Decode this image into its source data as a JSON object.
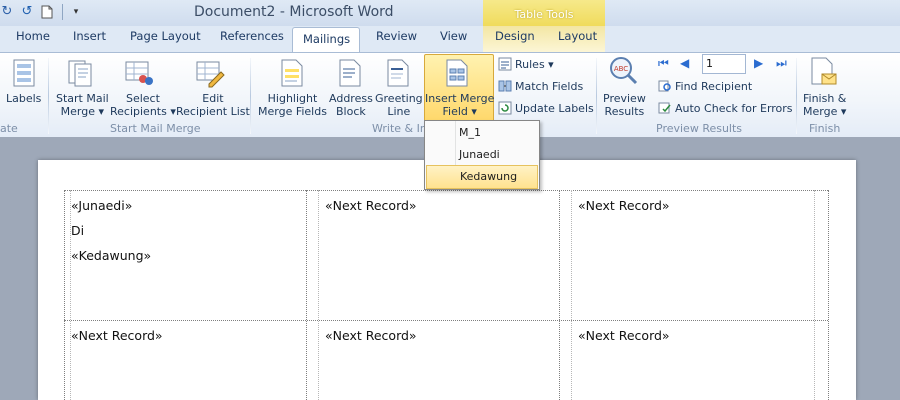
{
  "window": {
    "title": "Document2 - Microsoft Word",
    "contextual_tab_group": "Table Tools"
  },
  "tabs": [
    "Home",
    "Insert",
    "Page Layout",
    "References",
    "Mailings",
    "Review",
    "View",
    "Design",
    "Layout"
  ],
  "active_tab": "Mailings",
  "ribbon": {
    "create": {
      "labels_label": "Labels",
      "group_label": "ate"
    },
    "start_mail_merge": {
      "start_mail_merge": "Start Mail",
      "start_mail_merge_2": "Merge",
      "select_recipients": "Select",
      "select_recipients_2": "Recipients",
      "edit_recipient_list": "Edit",
      "edit_recipient_list_2": "Recipient List",
      "group_label": "Start Mail Merge"
    },
    "write_insert": {
      "highlight": "Highlight",
      "highlight_2": "Merge Fields",
      "address_block": "Address",
      "address_block_2": "Block",
      "greeting_line": "Greeting",
      "greeting_line_2": "Line",
      "insert_merge_field": "Insert Merge",
      "insert_merge_field_2": "Field",
      "rules": "Rules",
      "match_fields": "Match Fields",
      "update_labels": "Update Labels",
      "group_label": "Write & In"
    },
    "preview": {
      "preview_results": "Preview",
      "preview_results_2": "Results",
      "record_number": "1",
      "find_recipient": "Find Recipient",
      "auto_check": "Auto Check for Errors",
      "group_label": "Preview Results"
    },
    "finish": {
      "finish_merge": "Finish &",
      "finish_merge_2": "Merge",
      "group_label": "Finish"
    }
  },
  "merge_field_dropdown": [
    "M_1",
    "Junaedi",
    "Kedawung"
  ],
  "highlighted_dropdown_item": "Kedawung",
  "document": {
    "cells": [
      [
        "«Junaedi»",
        "Di",
        "«Kedawung»"
      ],
      [
        "«Next Record»"
      ],
      [
        "«Next Record»"
      ],
      [
        "«Next Record»"
      ],
      [
        "«Next Record»"
      ],
      [
        "«Next Record»"
      ]
    ]
  },
  "colors": {
    "contextual_yellow": "#efd955",
    "ribbon_text": "#1e395b"
  }
}
